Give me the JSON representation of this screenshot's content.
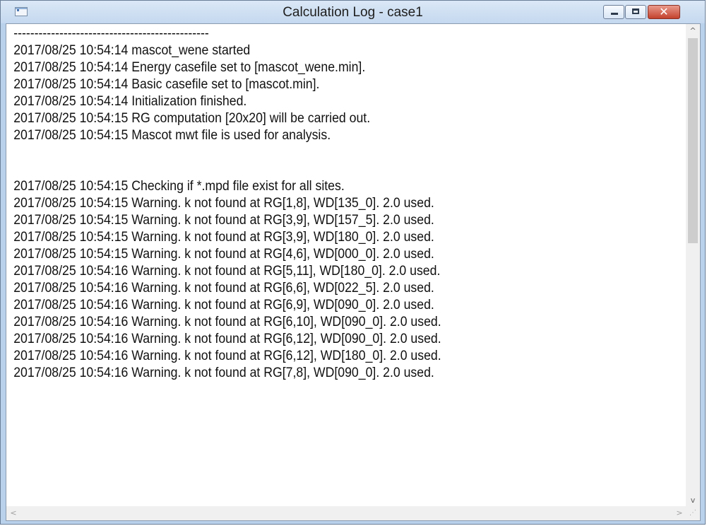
{
  "window": {
    "title": "Calculation Log - case1",
    "icons": {
      "app": "app-window-icon",
      "minimize": "minimize-icon",
      "maximize": "maximize-icon",
      "close": "close-icon"
    },
    "close_glyph": "✕",
    "close_color": "#c3422d"
  },
  "log": {
    "lines": [
      "-----------------------------------------------",
      "2017/08/25 10:54:14 mascot_wene started",
      "2017/08/25 10:54:14 Energy casefile set to [mascot_wene.min].",
      "2017/08/25 10:54:14 Basic casefile set to [mascot.min].",
      "2017/08/25 10:54:14 Initialization finished.",
      "2017/08/25 10:54:15 RG computation [20x20] will be carried out.",
      "2017/08/25 10:54:15 Mascot mwt file is used for analysis.",
      "",
      "",
      "2017/08/25 10:54:15 Checking if *.mpd file exist for all sites.",
      "2017/08/25 10:54:15 Warning. k not found at RG[1,8], WD[135_0]. 2.0 used.",
      "2017/08/25 10:54:15 Warning. k not found at RG[3,9], WD[157_5]. 2.0 used.",
      "2017/08/25 10:54:15 Warning. k not found at RG[3,9], WD[180_0]. 2.0 used.",
      "2017/08/25 10:54:15 Warning. k not found at RG[4,6], WD[000_0]. 2.0 used.",
      "2017/08/25 10:54:16 Warning. k not found at RG[5,11], WD[180_0]. 2.0 used.",
      "2017/08/25 10:54:16 Warning. k not found at RG[6,6], WD[022_5]. 2.0 used.",
      "2017/08/25 10:54:16 Warning. k not found at RG[6,9], WD[090_0]. 2.0 used.",
      "2017/08/25 10:54:16 Warning. k not found at RG[6,10], WD[090_0]. 2.0 used.",
      "2017/08/25 10:54:16 Warning. k not found at RG[6,12], WD[090_0]. 2.0 used.",
      "2017/08/25 10:54:16 Warning. k not found at RG[6,12], WD[180_0]. 2.0 used.",
      "2017/08/25 10:54:16 Warning. k not found at RG[7,8], WD[090_0]. 2.0 used."
    ]
  },
  "scrollbars": {
    "up_glyph": "^",
    "down_glyph": "v",
    "left_glyph": "<",
    "right_glyph": ">",
    "grip_glyph": "⋰",
    "icons": {
      "up": "scroll-up-arrow-icon",
      "down": "scroll-down-arrow-icon",
      "left": "scroll-left-arrow-icon",
      "right": "scroll-right-arrow-icon",
      "grip": "size-grip-icon"
    }
  }
}
